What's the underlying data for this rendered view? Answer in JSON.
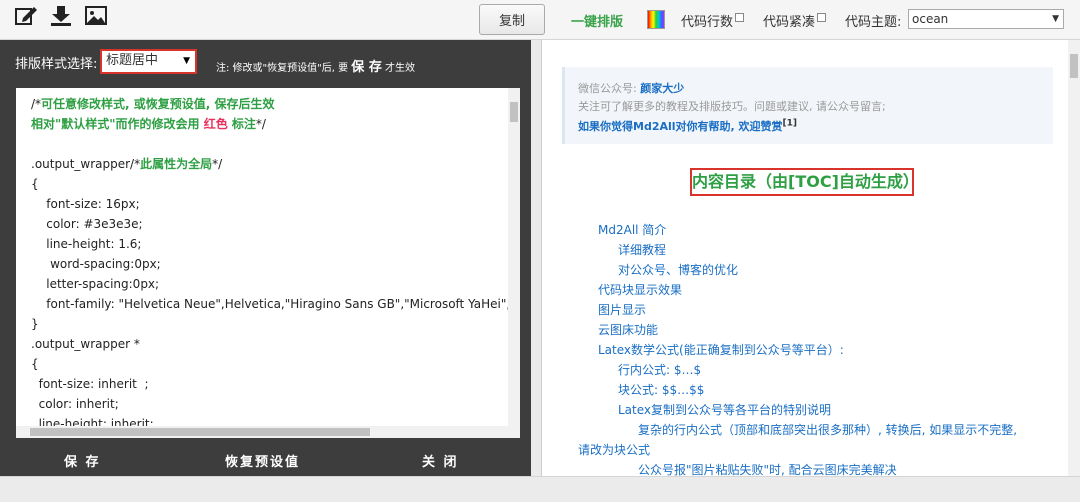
{
  "toolbar": {
    "icons": [
      "edit-icon",
      "download-icon",
      "image-icon"
    ],
    "copy_label": "复制",
    "one_click_label": "一键排版",
    "line_numbers_label": "代码行数",
    "compact_label": "代码紧凑",
    "theme_label": "代码主题:",
    "theme_value": "ocean"
  },
  "left": {
    "style_label": "排版样式选择:",
    "style_value": "标题居中",
    "note_prefix": "注: 修改或\"恢复预设值\"后, 要",
    "note_save": "保 存",
    "note_suffix": "才生效",
    "code_lines": [
      {
        "parts": [
          {
            "t": "/*"
          },
          {
            "t": "可任意修改样式, 或恢复预设值, 保存后生效",
            "c": "g"
          }
        ]
      },
      {
        "parts": [
          {
            "t": "相对\"默认样式\"而作的修改会用 ",
            "c": "g"
          },
          {
            "t": "红色",
            "c": "r"
          },
          {
            "t": " 标注",
            "c": "g"
          },
          {
            "t": "*/"
          }
        ]
      },
      {
        "parts": [
          {
            "t": ""
          }
        ]
      },
      {
        "parts": [
          {
            "t": ".output_wrapper/*"
          },
          {
            "t": "此属性为全局",
            "c": "g"
          },
          {
            "t": "*/"
          }
        ]
      },
      {
        "parts": [
          {
            "t": "{"
          }
        ]
      },
      {
        "parts": [
          {
            "t": "    font-size: 16px;"
          }
        ]
      },
      {
        "parts": [
          {
            "t": "    color: #3e3e3e;"
          }
        ]
      },
      {
        "parts": [
          {
            "t": "    line-height: 1.6;"
          }
        ]
      },
      {
        "parts": [
          {
            "t": "     word-spacing:0px;"
          }
        ]
      },
      {
        "parts": [
          {
            "t": "    letter-spacing:0px;"
          }
        ]
      },
      {
        "parts": [
          {
            "t": "    font-family: \"Helvetica Neue\",Helvetica,\"Hiragino Sans GB\",\"Microsoft YaHei\",Arial,s"
          }
        ]
      },
      {
        "parts": [
          {
            "t": "}"
          }
        ]
      },
      {
        "parts": [
          {
            "t": ".output_wrapper *"
          }
        ]
      },
      {
        "parts": [
          {
            "t": "{"
          }
        ]
      },
      {
        "parts": [
          {
            "t": "  font-size: inherit  ;"
          }
        ]
      },
      {
        "parts": [
          {
            "t": "  color: inherit;"
          }
        ]
      },
      {
        "parts": [
          {
            "t": "  line-height: inherit;"
          }
        ]
      }
    ],
    "save_label": "保 存",
    "restore_label": "恢复预设值",
    "close_label": "关 闭"
  },
  "right": {
    "notice_prefix": "微信公众号: ",
    "notice_account": "颜家大少",
    "notice_line2": "关注可了解更多的教程及排版技巧。问题或建议, 请公众号留言;",
    "notice_help": "如果你觉得Md2All对你有帮助, 欢迎赞赏",
    "notice_sup": "[1]",
    "toc_title": "内容目录（由[TOC]自动生成）",
    "toc_items": [
      "Md2All 简介",
      "详细教程",
      "对公众号、博客的优化",
      "代码块显示效果",
      "图片显示",
      "云图床功能",
      "Latex数学公式(能正确复制到公众号等平台）:",
      "行内公式: $…$",
      "块公式: $$…$$",
      "Latex复制到公众号等各平台的特别说明",
      "复杂的行内公式（顶部和底部突出很多那种）, 转换后, 如果显示不完整,",
      "请改为块公式",
      "公众号报\"图片粘贴失败\"时, 配合云图床完美解决"
    ]
  },
  "colors": {
    "accent_green": "#2ea043",
    "accent_red": "#d9342b",
    "link_blue": "#1a6fc4",
    "panel_dark": "#3d3d3d"
  }
}
